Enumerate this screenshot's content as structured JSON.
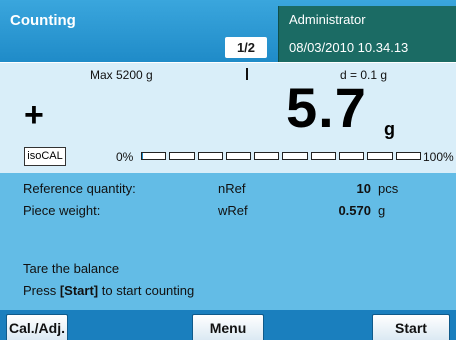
{
  "header": {
    "title": "Counting",
    "page_indicator": "1/2",
    "user": "Administrator",
    "datetime": "08/03/2010 10.34.13"
  },
  "weight": {
    "max_capacity": "Max 5200 g",
    "readability": "d = 0.1 g",
    "sign": "+",
    "value": "5.7",
    "unit": "g",
    "isocal_label": "isoCAL",
    "range_min_label": "0%",
    "range_max_label": "100%",
    "capacity_used_fraction": 0.0011
  },
  "info": {
    "rows": [
      {
        "label": "Reference quantity:",
        "symbol": "nRef",
        "value": "10",
        "unit": "pcs"
      },
      {
        "label": "Piece weight:",
        "symbol": "wRef",
        "value": "0.570",
        "unit": "g"
      }
    ],
    "message_line1": "Tare the balance",
    "message_line2_prefix": "Press ",
    "message_line2_key": "[Start]",
    "message_line2_suffix": " to start counting"
  },
  "softkeys": {
    "left": "Cal./Adj.",
    "center": "Menu",
    "right": "Start"
  },
  "colors": {
    "header": "#1f8bc8",
    "user_panel": "#1b6b64",
    "weight_panel": "#d9eef9",
    "info_panel": "#63bce6",
    "softkey_bar": "#1a7fbe"
  }
}
